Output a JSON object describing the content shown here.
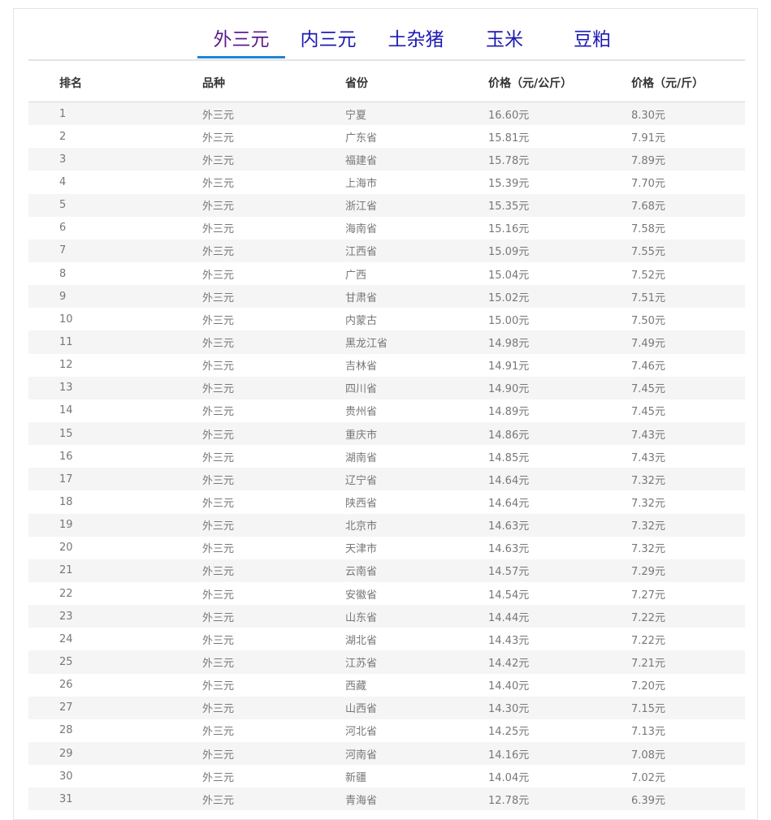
{
  "tabs": [
    {
      "label": "外三元",
      "active": true
    },
    {
      "label": "内三元",
      "active": false
    },
    {
      "label": "土杂猪",
      "active": false
    },
    {
      "label": "玉米",
      "active": false
    },
    {
      "label": "豆粕",
      "active": false
    }
  ],
  "table": {
    "headers": [
      "排名",
      "品种",
      "省份",
      "价格（元/公斤）",
      "价格（元/斤）"
    ],
    "rows": [
      [
        "1",
        "外三元",
        "宁夏",
        "16.60元",
        "8.30元"
      ],
      [
        "2",
        "外三元",
        "广东省",
        "15.81元",
        "7.91元"
      ],
      [
        "3",
        "外三元",
        "福建省",
        "15.78元",
        "7.89元"
      ],
      [
        "4",
        "外三元",
        "上海市",
        "15.39元",
        "7.70元"
      ],
      [
        "5",
        "外三元",
        "浙江省",
        "15.35元",
        "7.68元"
      ],
      [
        "6",
        "外三元",
        "海南省",
        "15.16元",
        "7.58元"
      ],
      [
        "7",
        "外三元",
        "江西省",
        "15.09元",
        "7.55元"
      ],
      [
        "8",
        "外三元",
        "广西",
        "15.04元",
        "7.52元"
      ],
      [
        "9",
        "外三元",
        "甘肃省",
        "15.02元",
        "7.51元"
      ],
      [
        "10",
        "外三元",
        "内蒙古",
        "15.00元",
        "7.50元"
      ],
      [
        "11",
        "外三元",
        "黑龙江省",
        "14.98元",
        "7.49元"
      ],
      [
        "12",
        "外三元",
        "吉林省",
        "14.91元",
        "7.46元"
      ],
      [
        "13",
        "外三元",
        "四川省",
        "14.90元",
        "7.45元"
      ],
      [
        "14",
        "外三元",
        "贵州省",
        "14.89元",
        "7.45元"
      ],
      [
        "15",
        "外三元",
        "重庆市",
        "14.86元",
        "7.43元"
      ],
      [
        "16",
        "外三元",
        "湖南省",
        "14.85元",
        "7.43元"
      ],
      [
        "17",
        "外三元",
        "辽宁省",
        "14.64元",
        "7.32元"
      ],
      [
        "18",
        "外三元",
        "陕西省",
        "14.64元",
        "7.32元"
      ],
      [
        "19",
        "外三元",
        "北京市",
        "14.63元",
        "7.32元"
      ],
      [
        "20",
        "外三元",
        "天津市",
        "14.63元",
        "7.32元"
      ],
      [
        "21",
        "外三元",
        "云南省",
        "14.57元",
        "7.29元"
      ],
      [
        "22",
        "外三元",
        "安徽省",
        "14.54元",
        "7.27元"
      ],
      [
        "23",
        "外三元",
        "山东省",
        "14.44元",
        "7.22元"
      ],
      [
        "24",
        "外三元",
        "湖北省",
        "14.43元",
        "7.22元"
      ],
      [
        "25",
        "外三元",
        "江苏省",
        "14.42元",
        "7.21元"
      ],
      [
        "26",
        "外三元",
        "西藏",
        "14.40元",
        "7.20元"
      ],
      [
        "27",
        "外三元",
        "山西省",
        "14.30元",
        "7.15元"
      ],
      [
        "28",
        "外三元",
        "河北省",
        "14.25元",
        "7.13元"
      ],
      [
        "29",
        "外三元",
        "河南省",
        "14.16元",
        "7.08元"
      ],
      [
        "30",
        "外三元",
        "新疆",
        "14.04元",
        "7.02元"
      ],
      [
        "31",
        "外三元",
        "青海省",
        "12.78元",
        "6.39元"
      ]
    ]
  },
  "colors": {
    "tab_active": "#5b1a8f",
    "tab_inactive": "#1e1ab3",
    "tab_underline": "#1f86d6",
    "row_stripe": "#f5f5f5"
  }
}
